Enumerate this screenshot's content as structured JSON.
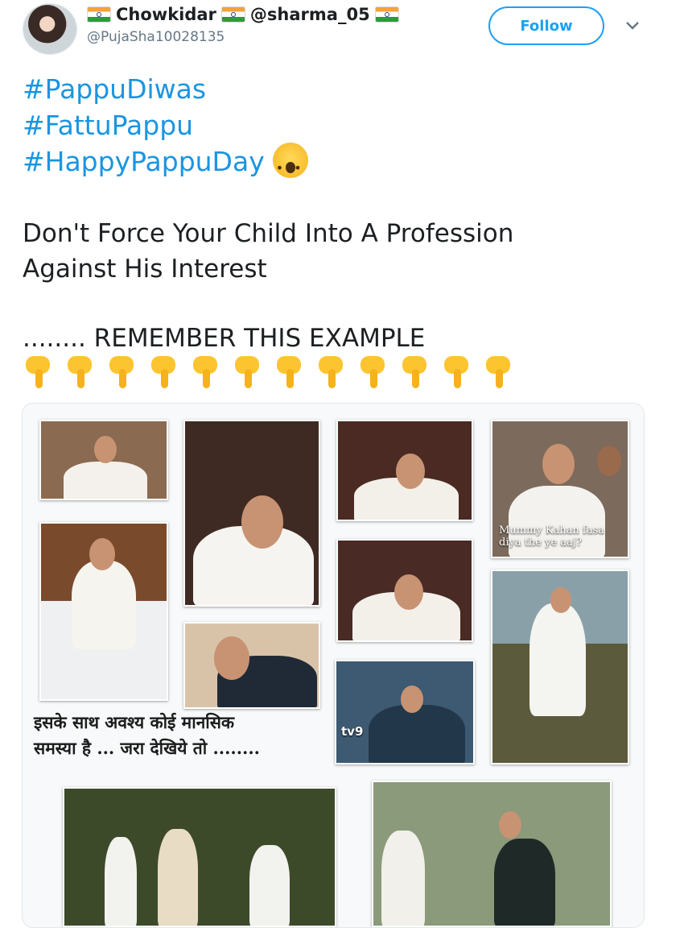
{
  "tweet": {
    "display_name": {
      "part1": "Chowkidar",
      "part2": "@sharma_05"
    },
    "handle": "@PujaSha10028135",
    "follow_label": "Follow",
    "hashtags": [
      "#PappuDiwas",
      "#FattuPappu",
      "#HappyPappuDay"
    ],
    "body_lines": [
      "Don't Force Your Child Into A Profession",
      "Against His Interest"
    ],
    "remember_line": "........ REMEMBER THIS EXAMPLE",
    "pointing_down_count": 12
  },
  "media": {
    "photo_caption": "Mummy Kahan fasa diya the ye aaj?",
    "channel_logo": "tv9",
    "hindi_lines": [
      "इसके साथ अवश्य कोई मानसिक",
      "समस्या है ... जरा देखिये तो ........"
    ]
  },
  "icons": {
    "flag": "india-flag-icon",
    "caret": "chevron-down-icon",
    "shock": "astonished-face-emoji",
    "hand": "backhand-index-pointing-down-emoji"
  },
  "colors": {
    "link": "#1b95e0",
    "follow": "#1da1f2",
    "muted": "#657786"
  }
}
